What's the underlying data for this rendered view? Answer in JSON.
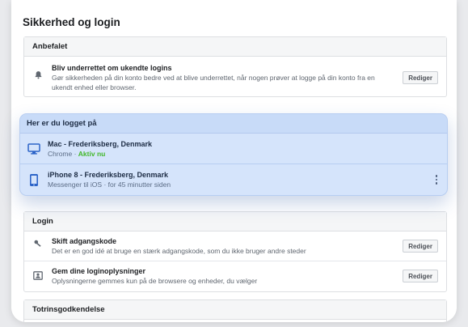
{
  "page": {
    "title": "Sikkerhed og login"
  },
  "recommended": {
    "header": "Anbefalet",
    "item": {
      "icon": "bell-icon",
      "title": "Bliv underrettet om ukendte logins",
      "subtitle_line1": "Gør sikkerheden på din konto bedre ved at blive underrettet, når nogen prøver at logge på din konto fra en",
      "subtitle_line2": "ukendt enhed eller browser.",
      "edit_label": "Rediger"
    }
  },
  "where_logged_in": {
    "header": "Her er du logget på",
    "sessions": [
      {
        "icon": "desktop-icon",
        "title": "Mac - Frederiksberg, Denmark",
        "subtitle": "Chrome · ",
        "status": "Aktiv nu"
      },
      {
        "icon": "phone-icon",
        "title": "iPhone 8 - Frederiksberg, Denmark",
        "subtitle": "Messenger til iOS · for 45 minutter siden"
      }
    ]
  },
  "login": {
    "header": "Login",
    "items": [
      {
        "icon": "key-icon",
        "title": "Skift adgangskode",
        "subtitle": "Det er en god idé at bruge en stærk adgangskode, som du ikke bruger andre steder",
        "edit_label": "Rediger"
      },
      {
        "icon": "id-card-icon",
        "title": "Gem dine loginoplysninger",
        "subtitle": "Oplysningerne gemmes kun på de browsere og enheder, du vælger",
        "edit_label": "Rediger"
      }
    ]
  },
  "two_factor": {
    "header": "Totrinsgodkendelse"
  },
  "colors": {
    "accent": "#1877f2",
    "active": "#42b72a",
    "highlight": "#d5e4fb"
  }
}
